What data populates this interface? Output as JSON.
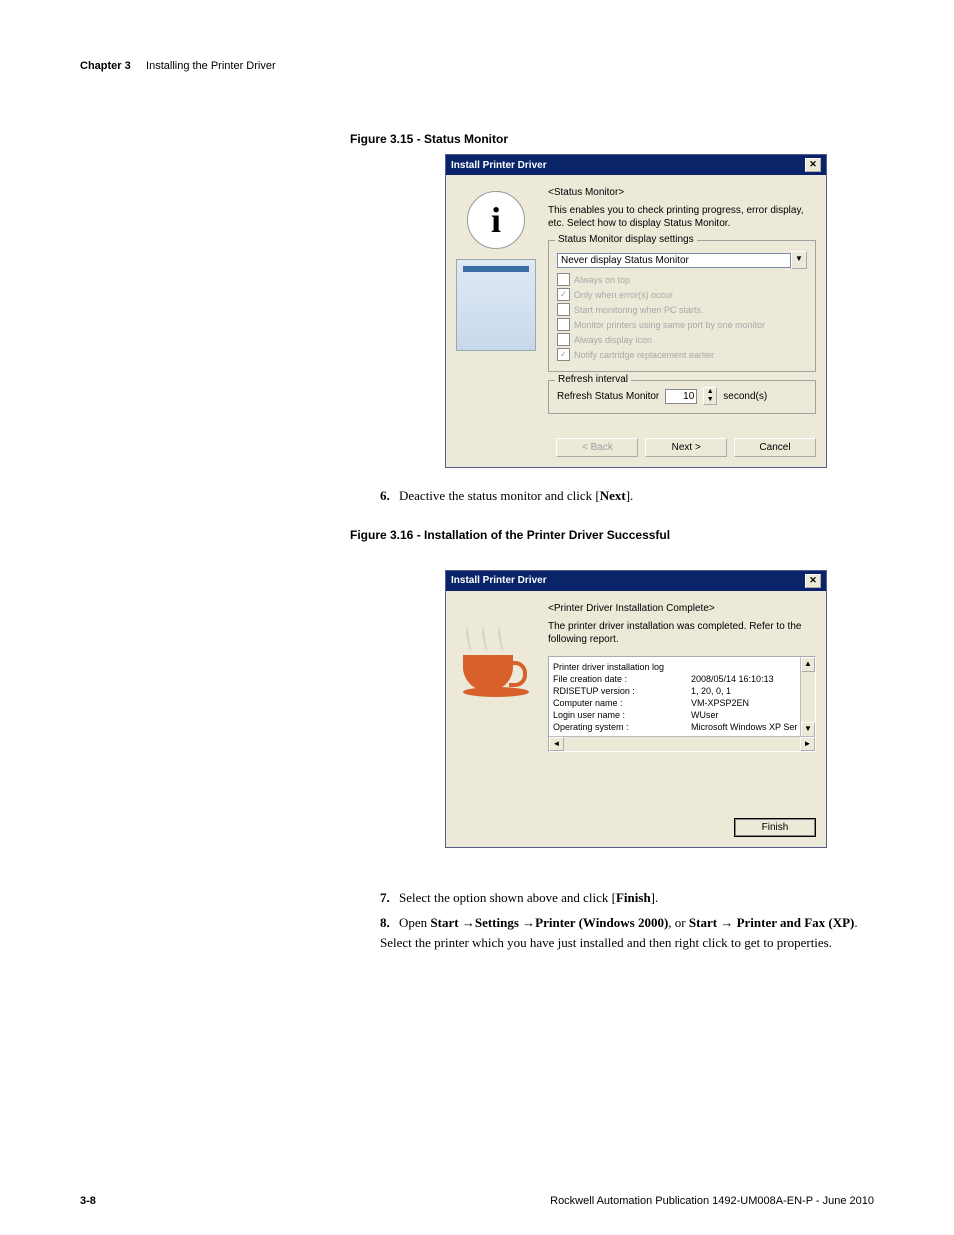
{
  "header": {
    "chapter_label": "Chapter 3",
    "chapter_title": "Installing the Printer Driver"
  },
  "figure1": {
    "caption": "Figure 3.15 - Status Monitor",
    "title": "Install Printer Driver",
    "section": "<Status Monitor>",
    "desc": "This enables you to check printing progress, error display, etc. Select how to display Status Monitor.",
    "group1_title": "Status Monitor display settings",
    "dropdown": "Never display Status Monitor",
    "opts": {
      "always_top": "Always on top",
      "only_errors": "Only when error(s) occur",
      "start_pc": "Start monitoring when PC starts.",
      "monitor_port": "Monitor printers using same port by one monitor",
      "always_icon": "Always display icon",
      "notify": "Notify cartridge replacement earlier"
    },
    "group2_title": "Refresh interval",
    "refresh_label": "Refresh Status Monitor",
    "refresh_value": "10",
    "refresh_unit": "second(s)",
    "buttons": {
      "back": "< Back",
      "next": "Next >",
      "cancel": "Cancel"
    }
  },
  "step6": {
    "num": "6.",
    "before": "Deactive the status monitor and click [",
    "bold": "Next",
    "after": "]."
  },
  "figure2": {
    "caption": "Figure 3.16 - Installation of the Printer Driver Successful",
    "title": "Install Printer Driver",
    "section": "<Printer Driver Installation Complete>",
    "desc": "The printer driver installation was completed. Refer to the following report.",
    "report": {
      "header": "Printer driver installation log",
      "rows": [
        {
          "l": "File creation date :",
          "r": "2008/05/14 16:10:13"
        },
        {
          "l": "RDISETUP version :",
          "r": "1, 20, 0, 1"
        },
        {
          "l": "Computer name :",
          "r": "VM-XPSP2EN"
        },
        {
          "l": "Login user name :",
          "r": "WUser"
        },
        {
          "l": "Operating system :",
          "r": "Microsoft Windows XP Ser"
        }
      ]
    },
    "buttons": {
      "finish": "Finish"
    }
  },
  "step7": {
    "num": "7.",
    "before": "Select the option shown above and click [",
    "bold": "Finish",
    "after": "]."
  },
  "step8": {
    "num": "8.",
    "t1": "Open ",
    "b1": "Start",
    "arrow": " →",
    "b2": "Settings",
    "b3": "Printer (Windows 2000)",
    "t2": ", or ",
    "b4": "Start",
    "b5": " Printer and Fax (XP)",
    "t3": ". Select the printer which you have just installed and then right click to get to properties."
  },
  "footer": {
    "page": "3-8",
    "pub": "Rockwell Automation Publication 1492-UM008A-EN-P - June 2010"
  }
}
